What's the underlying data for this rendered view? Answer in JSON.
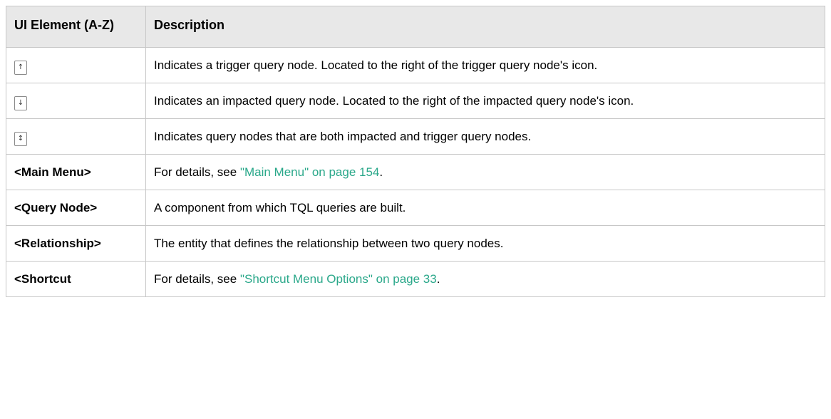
{
  "table": {
    "header": {
      "element": "UI Element (A-Z)",
      "description": "Description"
    },
    "rows": [
      {
        "icon": "trigger-arrow-up-icon",
        "glyph": "↑",
        "description": "Indicates a trigger query node. Located to the right of the trigger query node's icon."
      },
      {
        "icon": "impacted-arrow-down-icon",
        "glyph": "↓",
        "description": "Indicates an impacted query node. Located to the right of the impacted query node's icon."
      },
      {
        "icon": "both-arrows-icon",
        "glyph": "↕",
        "description": "Indicates query nodes that are both impacted and trigger query nodes."
      },
      {
        "element": "<Main Menu>",
        "description_prefix": "For details, see ",
        "link": "\"Main Menu\" on page 154",
        "description_suffix": "."
      },
      {
        "element": "<Query Node>",
        "description": "A component from which TQL queries are built."
      },
      {
        "element": "<Relationship>",
        "description": "The entity that defines the relationship between two query nodes."
      },
      {
        "element": "<Shortcut",
        "description_prefix": "For details, see ",
        "link": "\"Shortcut Menu Options\" on page 33",
        "description_suffix": "."
      }
    ]
  },
  "colors": {
    "link": "#2aa88a",
    "header_bg": "#e8e8e8",
    "border": "#c7c7c7"
  }
}
